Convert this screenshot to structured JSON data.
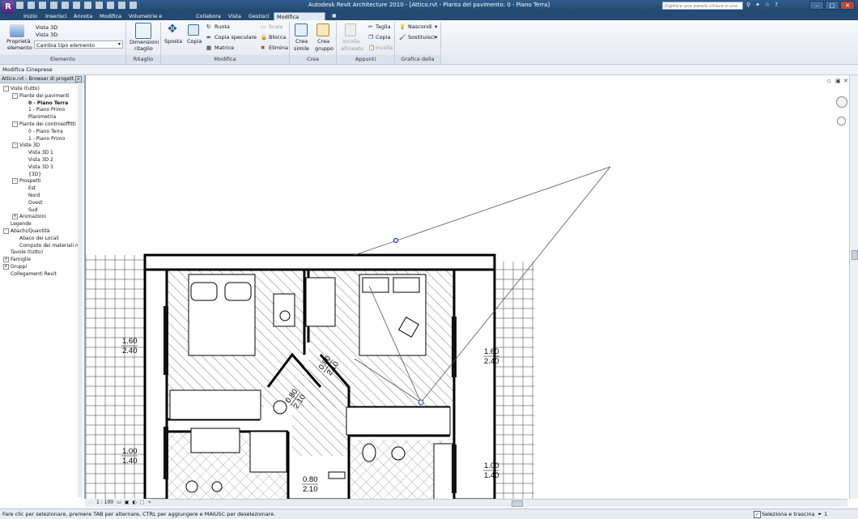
{
  "app": {
    "title": "Autodesk Revit Architecture 2010 - [Attico.rvt - Pianta del pavimento: 0 - Piano Terra]",
    "logo_letter": "R",
    "search_placeholder": "Digitare una parola chiave o una fra",
    "window_buttons": [
      "–",
      "□",
      "✕"
    ]
  },
  "tabs": [
    "Inizio",
    "Inserisci",
    "Annota",
    "Modifica",
    "Volumetrie e planimetria",
    "Collabora",
    "Vista",
    "Gestisci",
    "Modifica Cineprese"
  ],
  "active_tab": "Modifica Cineprese",
  "ribbon": {
    "elemento": {
      "properties": "Proprietà",
      "properties2": "elemento",
      "type1": "Vista 3D",
      "type2": "Vista 3D",
      "change_type": "Cambia tipo elemento",
      "label": "Elemento"
    },
    "ritaglio": {
      "btn1": "Dimensioni",
      "btn2": "ritaglio",
      "label": "Ritaglio"
    },
    "modifica": {
      "sposta": "Sposta",
      "copia": "Copia",
      "ruota": "Ruota",
      "copia_speculare": "Copia speculare",
      "matrice": "Matrice",
      "scala": "Scala",
      "blocca": "Blocca",
      "elimina": "Elimina",
      "label": "Modifica"
    },
    "crea": {
      "simile1": "Crea",
      "simile2": "simile",
      "gruppo1": "Crea",
      "gruppo2": "gruppo",
      "label": "Crea"
    },
    "appunti": {
      "incolla1": "Incolla",
      "incolla2": "allineato",
      "taglia": "Taglia",
      "copia": "Copia",
      "incolla": "Incolla",
      "label": "Appunti"
    },
    "grafica": {
      "nascondi": "Nascondi",
      "sostituisci": "Sostituisci",
      "label": "Grafica della vista"
    }
  },
  "context_bar": "Modifica Cineprese",
  "browser": {
    "title": "Attico.rvt - Browser di progett...",
    "items": [
      {
        "label": "Viste (tutto)",
        "level": 0,
        "sign": "-"
      },
      {
        "label": "Piante dei pavimenti",
        "level": 1,
        "sign": "-"
      },
      {
        "label": "0 - Piano Terra",
        "level": 2,
        "bold": true
      },
      {
        "label": "1 - Piano Primo",
        "level": 2
      },
      {
        "label": "Planimetria",
        "level": 2
      },
      {
        "label": "Piante dei controsoffitti",
        "level": 1,
        "sign": "-"
      },
      {
        "label": "0 - Piano Terra",
        "level": 2
      },
      {
        "label": "1 - Piano Primo",
        "level": 2
      },
      {
        "label": "Viste 3D",
        "level": 1,
        "sign": "-"
      },
      {
        "label": "Vista 3D 1",
        "level": 2
      },
      {
        "label": "Vista 3D 2",
        "level": 2
      },
      {
        "label": "Vista 3D 3",
        "level": 2
      },
      {
        "label": "{3D}",
        "level": 2
      },
      {
        "label": "Prospetti",
        "level": 1,
        "sign": "-"
      },
      {
        "label": "Est",
        "level": 2
      },
      {
        "label": "Nord",
        "level": 2
      },
      {
        "label": "Ovest",
        "level": 2
      },
      {
        "label": "Sud",
        "level": 2
      },
      {
        "label": "Animazioni",
        "level": 1,
        "sign": "+"
      },
      {
        "label": "Legende",
        "level": 0
      },
      {
        "label": "Abachi/Quantità",
        "level": 0,
        "sign": "-"
      },
      {
        "label": "Abaco dei Locali",
        "level": 1
      },
      {
        "label": "Computo dei materiali m",
        "level": 1
      },
      {
        "label": "Tavole (tutto)",
        "level": 0
      },
      {
        "label": "Famiglie",
        "level": 0,
        "sign": "+"
      },
      {
        "label": "Gruppi",
        "level": 0,
        "sign": "+"
      },
      {
        "label": "Collegamenti Revit",
        "level": 0
      }
    ]
  },
  "drawing": {
    "labels": [
      {
        "top": "1.60",
        "bottom": "2.40"
      },
      {
        "top": "0.80",
        "bottom": "2.10"
      },
      {
        "top": "0.80",
        "bottom": "2.10"
      },
      {
        "top": "1.60",
        "bottom": "2.40"
      },
      {
        "top": "1.00",
        "bottom": "1.40"
      },
      {
        "top": "0.80",
        "bottom": "2.10"
      },
      {
        "top": "1.00",
        "bottom": "1.40"
      }
    ]
  },
  "view_control": {
    "scale": "1 : 100"
  },
  "status": {
    "message": "Fare clic per selezionare, premere TAB per alternare, CTRL per aggiungere e MAIUSC per deselezionare.",
    "checkbox_label": "Seleziona e trascina",
    "filter_count": "1"
  }
}
